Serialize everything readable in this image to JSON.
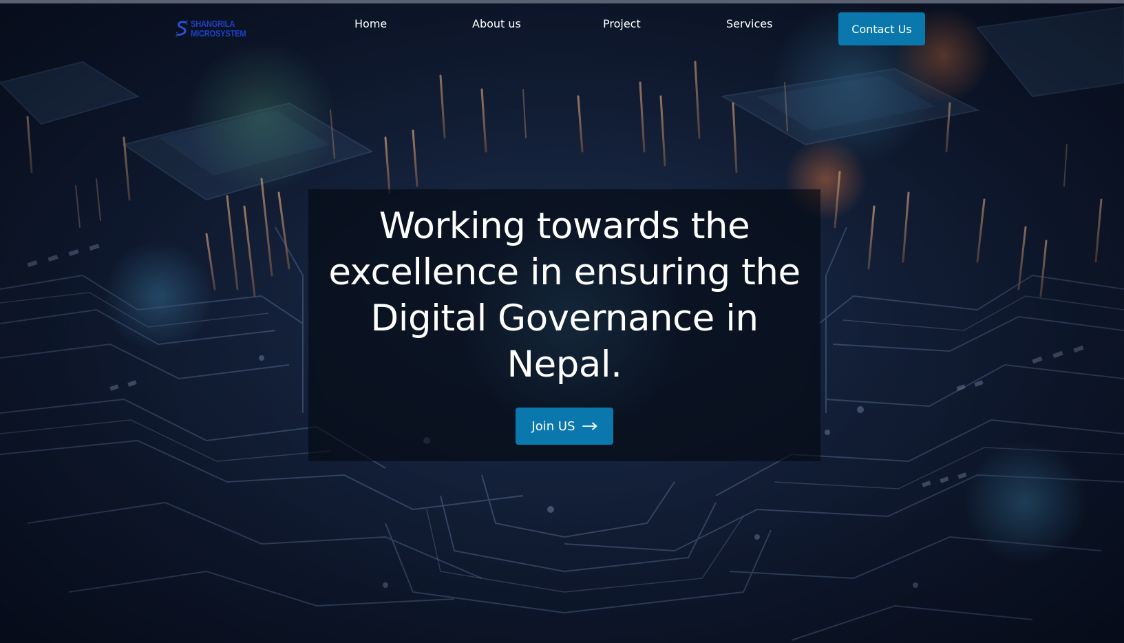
{
  "header": {
    "logo": {
      "line1": "SHANGRILA",
      "line2": "MICROSYSTEM",
      "icon": "logo-s-icon",
      "color": "#1f3fc4"
    },
    "nav": {
      "home": "Home",
      "about": "About us",
      "project": "Project",
      "services": "Services"
    },
    "contact_label": "Contact Us"
  },
  "hero": {
    "title": "Working towards the excellence in ensuring the Digital Governance in Nepal.",
    "join_label": "Join US",
    "join_icon": "arrow-right-icon"
  },
  "colors": {
    "accent": "#0a78ad",
    "background": "#0b1224",
    "text": "#ffffff"
  }
}
